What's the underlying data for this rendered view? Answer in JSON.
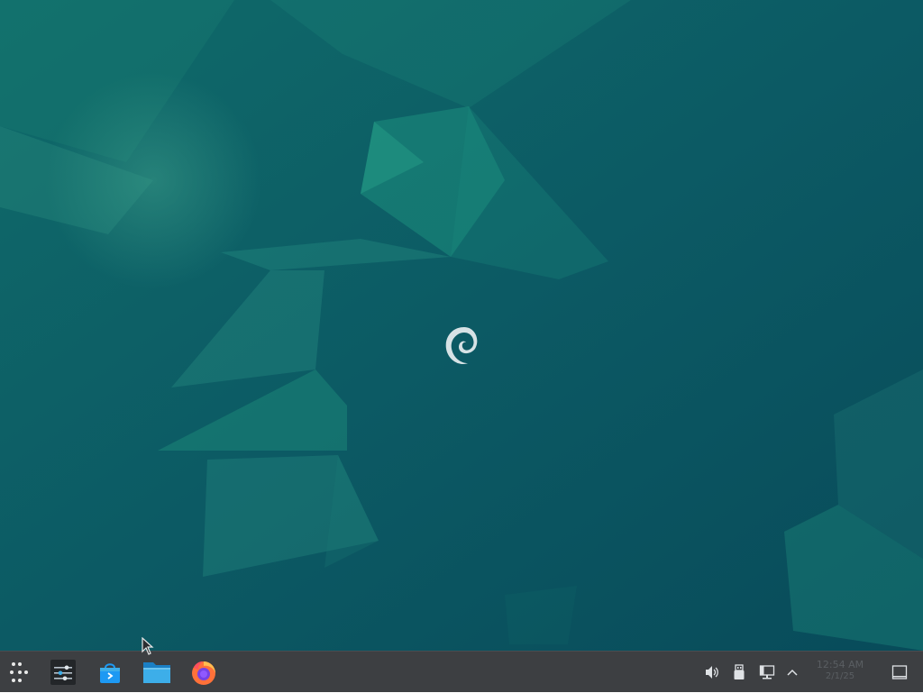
{
  "desktop": {
    "wallpaper_name": "debian-swirl-polygon-wallpaper",
    "center_logo_icon": "debian-swirl-icon"
  },
  "panel": {
    "launchers": [
      {
        "name": "application-launcher",
        "icon": "app-launcher-icon"
      },
      {
        "name": "system-settings",
        "icon": "settings-sliders-icon"
      },
      {
        "name": "discover-store",
        "icon": "store-bag-icon"
      },
      {
        "name": "file-manager",
        "icon": "folder-icon"
      },
      {
        "name": "firefox",
        "icon": "firefox-icon"
      }
    ],
    "tray": [
      {
        "name": "volume",
        "icon": "speaker-icon"
      },
      {
        "name": "removable-devices",
        "icon": "usb-drive-icon"
      },
      {
        "name": "network",
        "icon": "network-wired-icon"
      },
      {
        "name": "show-hidden-icons",
        "icon": "chevron-up-icon"
      }
    ],
    "clock": {
      "time": "12:54 AM",
      "date": "2/1/25"
    },
    "show_desktop_icon": "show-desktop-icon"
  },
  "colors": {
    "desktop_bg": "#0e5a63",
    "panel_bg": "#3d3f42",
    "accent_teal": "#1a8a7a"
  }
}
